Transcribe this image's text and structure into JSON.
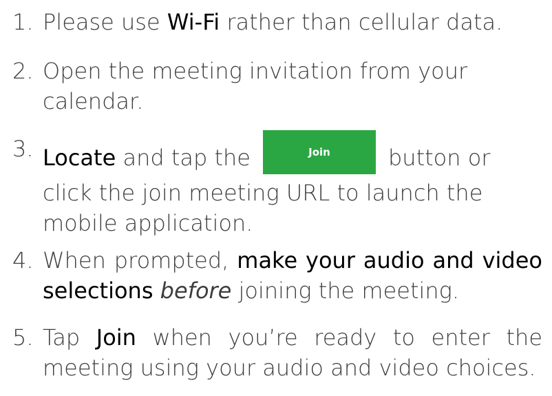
{
  "steps": [
    {
      "number": "1.",
      "parts": {
        "a": "Please use ",
        "b": "Wi-Fi",
        "c": " rather than cellular data."
      }
    },
    {
      "number": "2.",
      "parts": {
        "a": "Open the meeting invitation from your calendar."
      }
    },
    {
      "number": "3.",
      "parts": {
        "a": "Locate",
        "b": " and tap the",
        "c": "button or click the join meeting URL to launch the mobile application."
      },
      "button_label": "Join"
    },
    {
      "number": "4.",
      "parts": {
        "a": "When prompted, ",
        "b": "make your audio and video selections",
        "c": " ",
        "d": "before",
        "e": " joining the meeting."
      }
    },
    {
      "number": "5.",
      "parts": {
        "a": "Tap ",
        "b": "Join",
        "c": " when you’re ready to enter the meeting using your audio and video choices."
      }
    }
  ],
  "colors": {
    "join_button": "#2aa742",
    "text": "#3d3d3d",
    "emphasis": "#000000"
  }
}
